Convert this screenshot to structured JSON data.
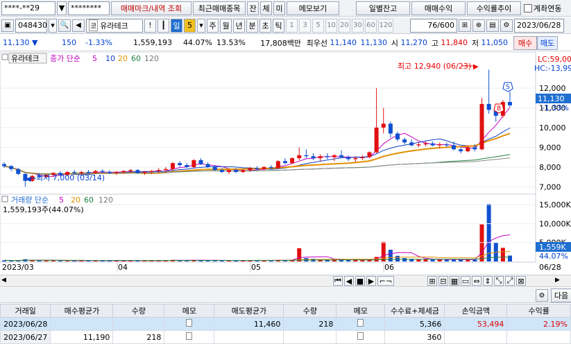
{
  "toolbar": {
    "account": "****-**29",
    "password": "********",
    "btn_trade_marks": "매매마크/내역 조회",
    "btn_recent": "최근매매종목",
    "btn_balance": "잔",
    "btn_exec": "체",
    "btn_unexec": "미",
    "btn_memo": "메모보기",
    "btn_daily": "일별잔고",
    "btn_profit": "매매수익",
    "btn_return_trend": "수익률추이",
    "chk_account_link": "계좌연동"
  },
  "stock": {
    "code": "048430",
    "market": "코",
    "name": "유라테크",
    "period_day": "일",
    "period_value": "5",
    "periods": [
      "주",
      "월",
      "년",
      "분",
      "초",
      "틱"
    ],
    "intervals": [
      "1",
      "3",
      "5",
      "10",
      "20",
      "30",
      "60",
      "120"
    ],
    "count": "76",
    "count_total": "/600",
    "date": "2023/06/28"
  },
  "quote": {
    "price": "11,130",
    "change": "150",
    "rate": "-1.33%",
    "volume": "1,559,193",
    "vol_ratio": "44.07%",
    "turnover": "13.53%",
    "amount": "17,808백만",
    "best_label": "최우선",
    "best_ask": "11,140",
    "best_bid": "11,130",
    "open_label": "시",
    "open": "11,270",
    "high_label": "고",
    "high": "11,840",
    "low_label": "저",
    "low": "11,050",
    "sell_btn": "매수",
    "buy_btn": "매도"
  },
  "chart": {
    "name": "유라테크",
    "legend_close": "종가 단순",
    "ma": [
      "5",
      "10",
      "20",
      "60",
      "120"
    ],
    "lc": "LC:59,00",
    "hc": "HC:-13,99",
    "high_annot": "최고 12,940 (06/23)",
    "low_annot": "최저 7,000 (03/14)",
    "price_label": "11,130",
    "price_rate": "-1.33%",
    "price_ticks": [
      "12,000",
      "11,000",
      "10,000",
      "9,000",
      "8,000",
      "7,000"
    ],
    "vol_legend": "거래량 단순",
    "vol_value": "1,559,193주(44.07%)",
    "vol_ticks": [
      "15,000K",
      "10,000K",
      "5,000K"
    ],
    "vol_label": "1,559K",
    "vol_pct": "44.07%",
    "x_ticks": [
      "2023/03",
      "04",
      "05",
      "06",
      "06/28"
    ],
    "mark_s": "S",
    "mark_b": "B"
  },
  "chart_data": {
    "type": "candlestick",
    "series": [
      {
        "name": "price",
        "values": [
          {
            "o": 8150,
            "h": 8250,
            "l": 7950,
            "c": 8050
          },
          {
            "o": 8050,
            "h": 8100,
            "l": 7800,
            "c": 7900
          },
          {
            "o": 7900,
            "h": 7950,
            "l": 7600,
            "c": 7650
          },
          {
            "o": 7650,
            "h": 7700,
            "l": 7000,
            "c": 7300
          },
          {
            "o": 7300,
            "h": 7600,
            "l": 7250,
            "c": 7550
          },
          {
            "o": 7550,
            "h": 7700,
            "l": 7450,
            "c": 7500
          },
          {
            "o": 7500,
            "h": 7650,
            "l": 7450,
            "c": 7600
          },
          {
            "o": 7600,
            "h": 7750,
            "l": 7500,
            "c": 7700
          },
          {
            "o": 7700,
            "h": 7800,
            "l": 7550,
            "c": 7600
          },
          {
            "o": 7600,
            "h": 7800,
            "l": 7550,
            "c": 7750
          },
          {
            "o": 7750,
            "h": 7850,
            "l": 7650,
            "c": 7700
          },
          {
            "o": 7700,
            "h": 7800,
            "l": 7600,
            "c": 7750
          },
          {
            "o": 7750,
            "h": 7850,
            "l": 7650,
            "c": 7700
          },
          {
            "o": 7700,
            "h": 7850,
            "l": 7650,
            "c": 7800
          },
          {
            "o": 7800,
            "h": 7900,
            "l": 7700,
            "c": 7750
          },
          {
            "o": 7750,
            "h": 7850,
            "l": 7650,
            "c": 7700
          },
          {
            "o": 7700,
            "h": 7800,
            "l": 7600,
            "c": 7750
          },
          {
            "o": 7750,
            "h": 7850,
            "l": 7650,
            "c": 7800
          },
          {
            "o": 7800,
            "h": 7900,
            "l": 7700,
            "c": 7850
          },
          {
            "o": 7850,
            "h": 7900,
            "l": 7650,
            "c": 7700
          },
          {
            "o": 7700,
            "h": 7800,
            "l": 7600,
            "c": 7750
          },
          {
            "o": 7750,
            "h": 7850,
            "l": 7650,
            "c": 7800
          },
          {
            "o": 7800,
            "h": 7950,
            "l": 7700,
            "c": 7850
          },
          {
            "o": 7850,
            "h": 8000,
            "l": 7750,
            "c": 7900
          },
          {
            "o": 7900,
            "h": 8250,
            "l": 7800,
            "c": 8200
          },
          {
            "o": 8200,
            "h": 8300,
            "l": 8000,
            "c": 8100
          },
          {
            "o": 8100,
            "h": 8200,
            "l": 7950,
            "c": 8000
          },
          {
            "o": 8000,
            "h": 8400,
            "l": 7950,
            "c": 8350
          },
          {
            "o": 8350,
            "h": 8450,
            "l": 8100,
            "c": 8150
          },
          {
            "o": 8150,
            "h": 8250,
            "l": 7950,
            "c": 8000
          },
          {
            "o": 8000,
            "h": 8100,
            "l": 7800,
            "c": 7850
          },
          {
            "o": 7850,
            "h": 7950,
            "l": 7700,
            "c": 7750
          },
          {
            "o": 7750,
            "h": 7900,
            "l": 7650,
            "c": 7850
          },
          {
            "o": 7850,
            "h": 7950,
            "l": 7700,
            "c": 7750
          },
          {
            "o": 7750,
            "h": 7900,
            "l": 7700,
            "c": 7850
          },
          {
            "o": 7850,
            "h": 8000,
            "l": 7750,
            "c": 7950
          },
          {
            "o": 7950,
            "h": 8050,
            "l": 7850,
            "c": 7900
          },
          {
            "o": 7900,
            "h": 8050,
            "l": 7800,
            "c": 8000
          },
          {
            "o": 8000,
            "h": 8100,
            "l": 7900,
            "c": 7950
          },
          {
            "o": 7950,
            "h": 8350,
            "l": 7900,
            "c": 8300
          },
          {
            "o": 8300,
            "h": 8450,
            "l": 8150,
            "c": 8200
          },
          {
            "o": 8200,
            "h": 8500,
            "l": 8150,
            "c": 8450
          },
          {
            "o": 8450,
            "h": 9000,
            "l": 8350,
            "c": 8600
          },
          {
            "o": 8600,
            "h": 8900,
            "l": 8450,
            "c": 8550
          },
          {
            "o": 8550,
            "h": 8700,
            "l": 8350,
            "c": 8450
          },
          {
            "o": 8450,
            "h": 8650,
            "l": 8300,
            "c": 8550
          },
          {
            "o": 8550,
            "h": 8700,
            "l": 8400,
            "c": 8500
          },
          {
            "o": 8500,
            "h": 8650,
            "l": 8300,
            "c": 8600
          },
          {
            "o": 8600,
            "h": 8850,
            "l": 8450,
            "c": 8500
          },
          {
            "o": 8500,
            "h": 8600,
            "l": 8300,
            "c": 8400
          },
          {
            "o": 8400,
            "h": 8550,
            "l": 8250,
            "c": 8450
          },
          {
            "o": 8450,
            "h": 8600,
            "l": 8350,
            "c": 8500
          },
          {
            "o": 8500,
            "h": 8800,
            "l": 8450,
            "c": 8750
          },
          {
            "o": 8750,
            "h": 12000,
            "l": 8700,
            "c": 10000
          },
          {
            "o": 10000,
            "h": 11000,
            "l": 9700,
            "c": 10200
          },
          {
            "o": 10200,
            "h": 10300,
            "l": 9500,
            "c": 9700
          },
          {
            "o": 9700,
            "h": 9800,
            "l": 9300,
            "c": 9400
          },
          {
            "o": 9400,
            "h": 9500,
            "l": 9150,
            "c": 9250
          },
          {
            "o": 9250,
            "h": 9400,
            "l": 9050,
            "c": 9100
          },
          {
            "o": 9100,
            "h": 9250,
            "l": 9000,
            "c": 9150
          },
          {
            "o": 9150,
            "h": 9300,
            "l": 9050,
            "c": 9200
          },
          {
            "o": 9200,
            "h": 9300,
            "l": 9050,
            "c": 9100
          },
          {
            "o": 9100,
            "h": 9250,
            "l": 8950,
            "c": 9150
          },
          {
            "o": 9150,
            "h": 9250,
            "l": 9000,
            "c": 9100
          },
          {
            "o": 9100,
            "h": 9300,
            "l": 8850,
            "c": 8900
          },
          {
            "o": 8900,
            "h": 9000,
            "l": 8700,
            "c": 8800
          },
          {
            "o": 8800,
            "h": 9100,
            "l": 8750,
            "c": 9000
          },
          {
            "o": 9000,
            "h": 9150,
            "l": 8800,
            "c": 8900
          },
          {
            "o": 8900,
            "h": 11500,
            "l": 8850,
            "c": 11200
          },
          {
            "o": 11200,
            "h": 12940,
            "l": 10700,
            "c": 10900
          },
          {
            "o": 10900,
            "h": 11200,
            "l": 10300,
            "c": 10600
          },
          {
            "o": 10600,
            "h": 11400,
            "l": 10500,
            "c": 11300
          },
          {
            "o": 11300,
            "h": 11840,
            "l": 11050,
            "c": 11130
          }
        ]
      }
    ],
    "volume_k": [
      300,
      250,
      220,
      600,
      350,
      280,
      240,
      260,
      230,
      250,
      220,
      240,
      230,
      260,
      240,
      220,
      230,
      250,
      240,
      220,
      230,
      260,
      280,
      300,
      420,
      350,
      300,
      380,
      330,
      290,
      260,
      250,
      270,
      250,
      260,
      280,
      270,
      290,
      280,
      420,
      380,
      450,
      3500,
      900,
      700,
      600,
      520,
      480,
      600,
      470,
      430,
      450,
      500,
      1200,
      5200,
      3100,
      1500,
      900,
      700,
      600,
      550,
      500,
      480,
      460,
      520,
      470,
      480,
      460,
      9800,
      15200,
      5000,
      3600,
      1559
    ],
    "ylim": [
      6800,
      13200
    ]
  }
}
